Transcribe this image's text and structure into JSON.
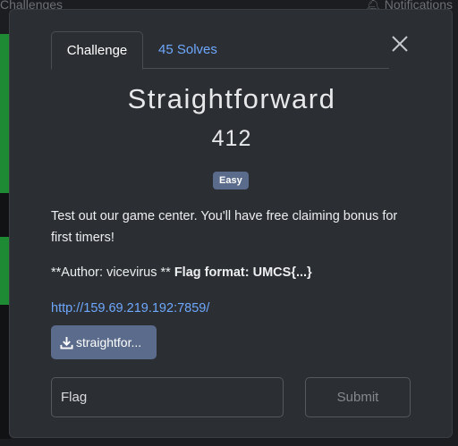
{
  "background": {
    "nav_left": "Challenges",
    "nav_right": "Notifications"
  },
  "modal": {
    "tabs": [
      {
        "label": "Challenge"
      },
      {
        "label": "45 Solves"
      }
    ],
    "title": "Straightforward",
    "points": "412",
    "difficulty": "Easy",
    "description": "Test out our game center. You'll have free claiming bonus for first timers!",
    "author_prefix": "**Author: vicevirus ** ",
    "flag_format": "Flag format: UMCS{...}",
    "link": "http://159.69.219.192:7859/",
    "file_label": "straightfor...",
    "flag_placeholder": "Flag",
    "submit_label": "Submit"
  },
  "colors": {
    "accent_link": "#6ea8fe",
    "badge": "#5a6b8c",
    "modal_bg": "#2b2e32"
  }
}
